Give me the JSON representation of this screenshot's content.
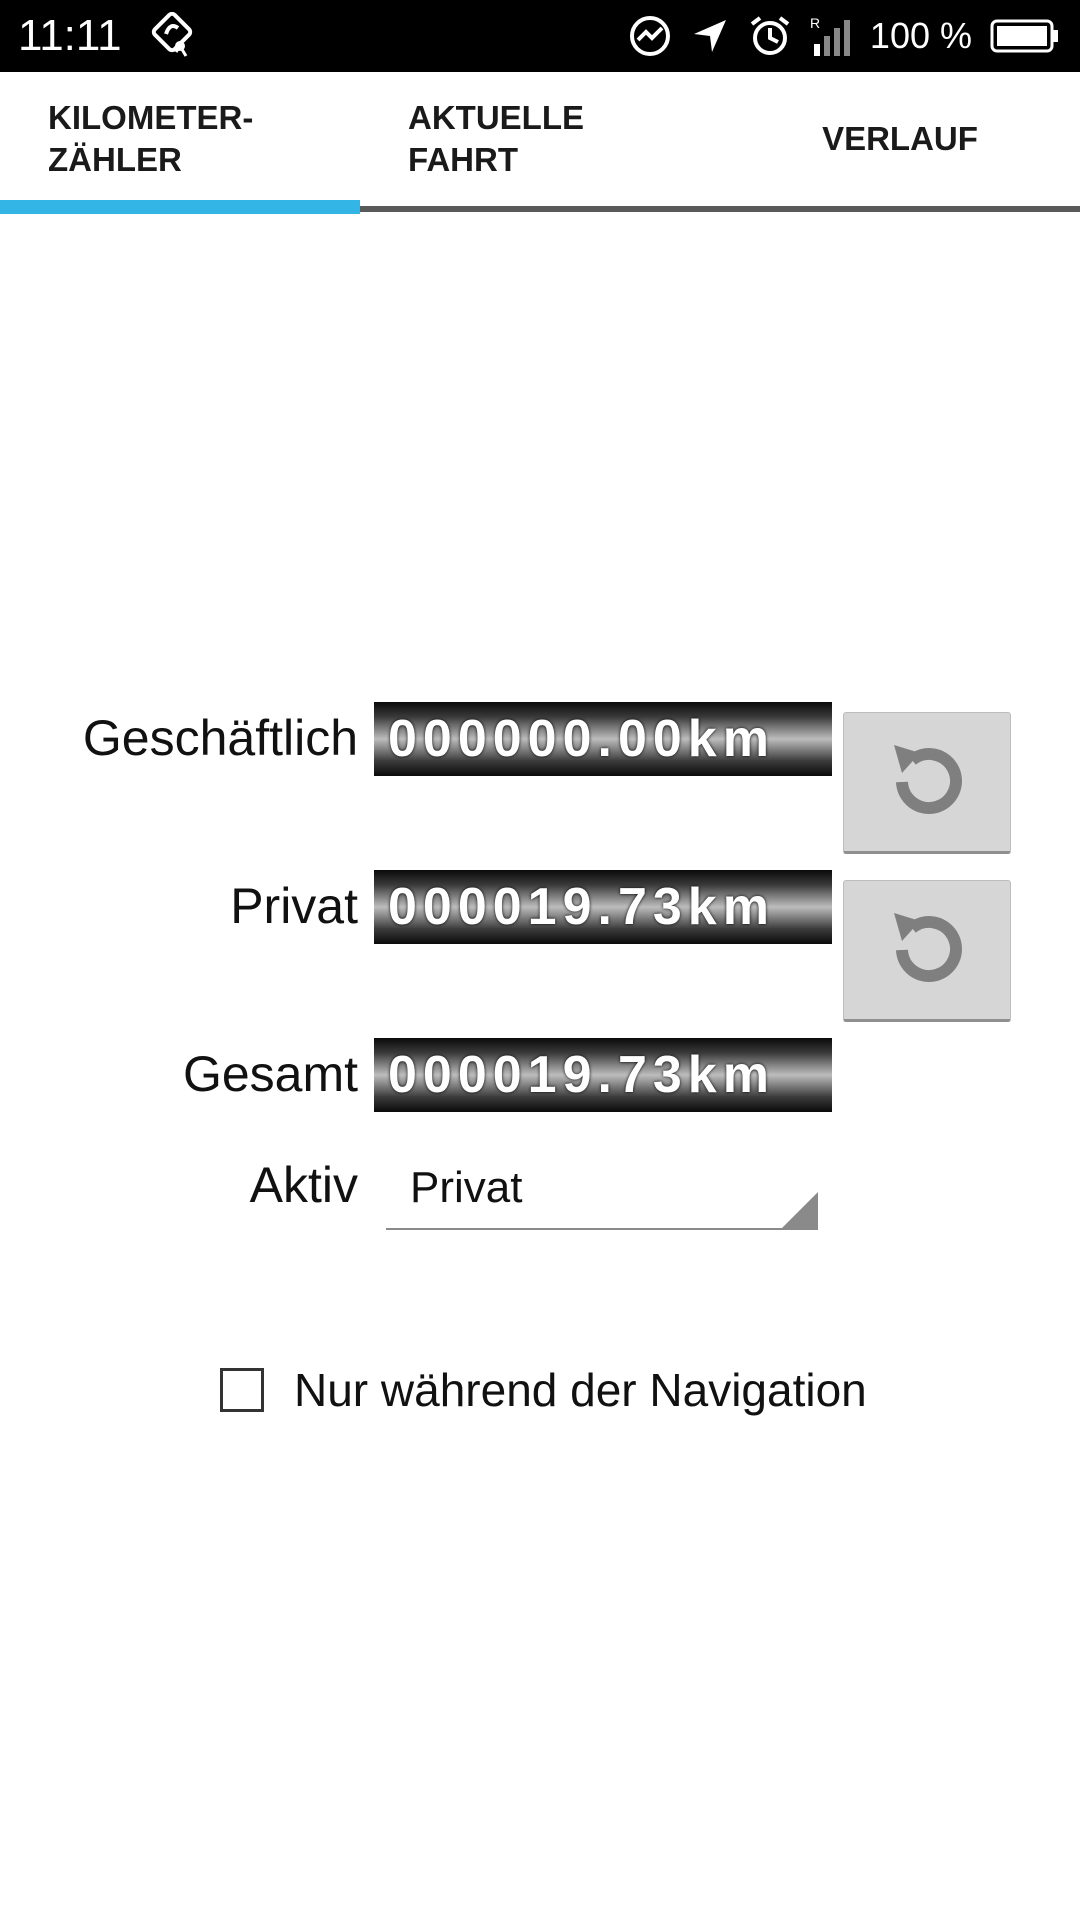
{
  "status_bar": {
    "time": "11:11",
    "app_icon": "navigation-app-icon",
    "icons": [
      "messenger-icon",
      "location-arrow-icon",
      "alarm-icon",
      "signal-roaming-icon"
    ],
    "battery_text": "100 %",
    "battery_icon": "battery-full-icon"
  },
  "tabs": [
    {
      "label": "KILOMETER-\nZÄHLER",
      "active": true
    },
    {
      "label": "AKTUELLE\nFAHRT",
      "active": false
    },
    {
      "label": "VERLAUF",
      "active": false
    }
  ],
  "colors": {
    "tab_indicator": "#33b5e5",
    "button_bg": "#d6d6d6",
    "icon_gray": "#7f7f7f"
  },
  "counters": {
    "business": {
      "label": "Geschäftlich",
      "value": "000000.00km"
    },
    "private": {
      "label": "Privat",
      "value": "000019.73km"
    },
    "total": {
      "label": "Gesamt",
      "value": "000019.73km"
    }
  },
  "active": {
    "label": "Aktiv",
    "selected": "Privat"
  },
  "checkbox": {
    "label": "Nur während der Navigation",
    "checked": false
  }
}
